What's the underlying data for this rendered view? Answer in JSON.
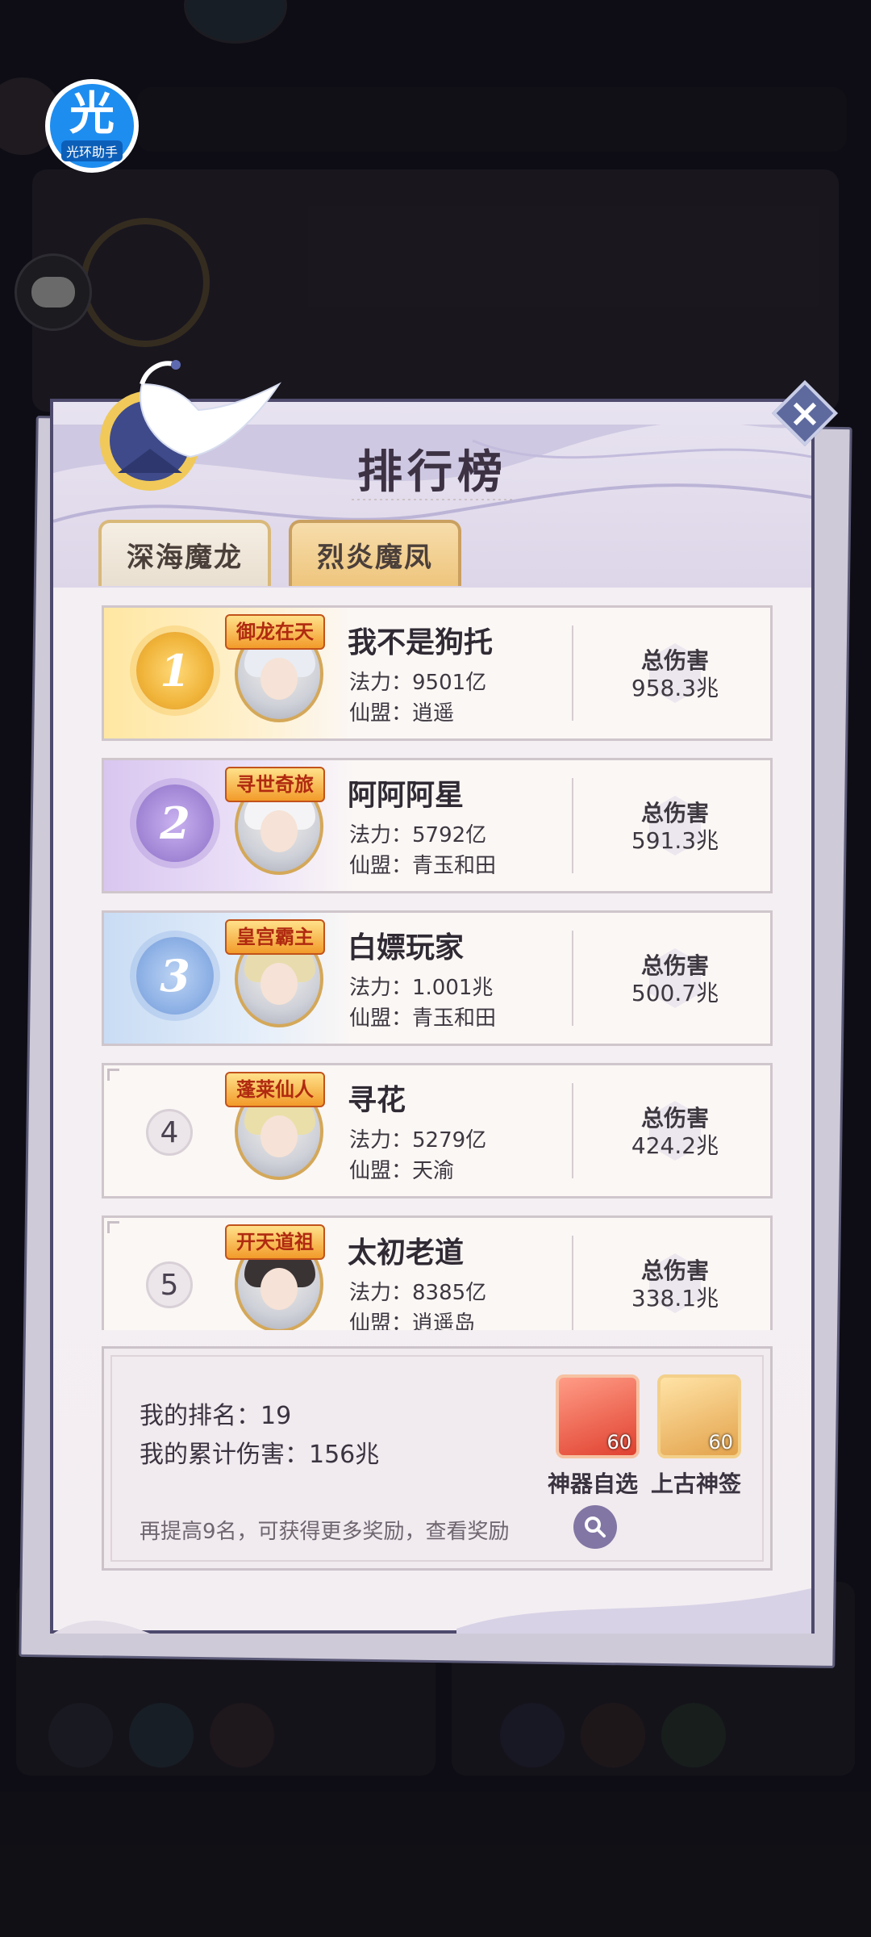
{
  "background": {
    "assist_badge": {
      "glyph": "光",
      "label": "光环助手"
    },
    "chat_icon": "chat-bubble-icon"
  },
  "leaderboard": {
    "title": "排行榜",
    "close_label": "×",
    "tabs": [
      {
        "label": "深海魔龙",
        "active": false
      },
      {
        "label": "烈炎魔凤",
        "active": true
      }
    ],
    "power_prefix": "法力：",
    "guild_prefix": "仙盟：",
    "damage_label": "总伤害",
    "entries": [
      {
        "rank": "1",
        "title_badge": "御龙在天",
        "name": "我不是狗托",
        "power": "法力：9501亿",
        "guild": "仙盟：逍遥",
        "damage_label": "总伤害",
        "damage": "958.3兆"
      },
      {
        "rank": "2",
        "title_badge": "寻世奇旅",
        "name": "阿阿阿星",
        "power": "法力：5792亿",
        "guild": "仙盟：青玉和田",
        "damage_label": "总伤害",
        "damage": "591.3兆"
      },
      {
        "rank": "3",
        "title_badge": "皇宫霸主",
        "name": "白嫖玩家",
        "power": "法力：1.001兆",
        "guild": "仙盟：青玉和田",
        "damage_label": "总伤害",
        "damage": "500.7兆"
      },
      {
        "rank": "4",
        "title_badge": "蓬莱仙人",
        "name": "寻花",
        "power": "法力：5279亿",
        "guild": "仙盟：天渝",
        "damage_label": "总伤害",
        "damage": "424.2兆"
      },
      {
        "rank": "5",
        "title_badge": "开天道祖",
        "name": "太初老道",
        "power": "法力：8385亿",
        "guild": "仙盟：逍遥岛",
        "damage_label": "总伤害",
        "damage": "338.1兆"
      }
    ],
    "my_info": {
      "rank_text": "我的排名：19",
      "damage_text": "我的累计伤害：156兆",
      "hint": "再提高9名，可获得更多奖励，查看奖励",
      "search_icon": "magnifier-icon",
      "rewards": [
        {
          "name": "神器自选",
          "qty": "60",
          "color": "#e0412f"
        },
        {
          "name": "上古神签",
          "qty": "60",
          "color": "#e3a24b"
        }
      ]
    }
  },
  "colors": {
    "gold": "#f4c04a",
    "purple": "#a58ad8",
    "blue": "#8fb2e6",
    "frame": "#4d4a6d"
  }
}
